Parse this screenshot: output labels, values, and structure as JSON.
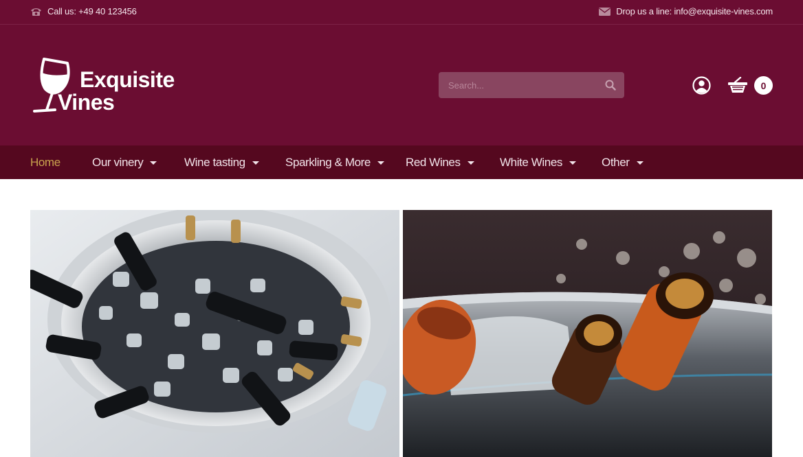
{
  "topbar": {
    "phone_text": "Call us: +49 40 123456",
    "email_text": "Drop us a line: info@exquisite-vines.com"
  },
  "brand": {
    "line1": "Exquisite",
    "line2": "Vines"
  },
  "search": {
    "placeholder": "Search..."
  },
  "cart": {
    "count": "0"
  },
  "nav": {
    "items": [
      {
        "label": "Home",
        "active": true,
        "dropdown": false
      },
      {
        "label": "Our vinery",
        "dropdown": true
      },
      {
        "label": "Wine tasting",
        "dropdown": true
      },
      {
        "label": "Sparkling & More",
        "dropdown": true
      },
      {
        "label": "Red Wines",
        "dropdown": true
      },
      {
        "label": "White Wines",
        "dropdown": true
      },
      {
        "label": "Other",
        "dropdown": true
      }
    ]
  },
  "colors": {
    "brand": "#6b0d32",
    "nav_bg": "#55081f",
    "accent": "#c9a34e"
  },
  "icons": [
    "phone-icon",
    "mail-icon",
    "wine-glass-logo-icon",
    "search-icon",
    "user-icon",
    "cart-icon",
    "chevron-down-icon"
  ]
}
